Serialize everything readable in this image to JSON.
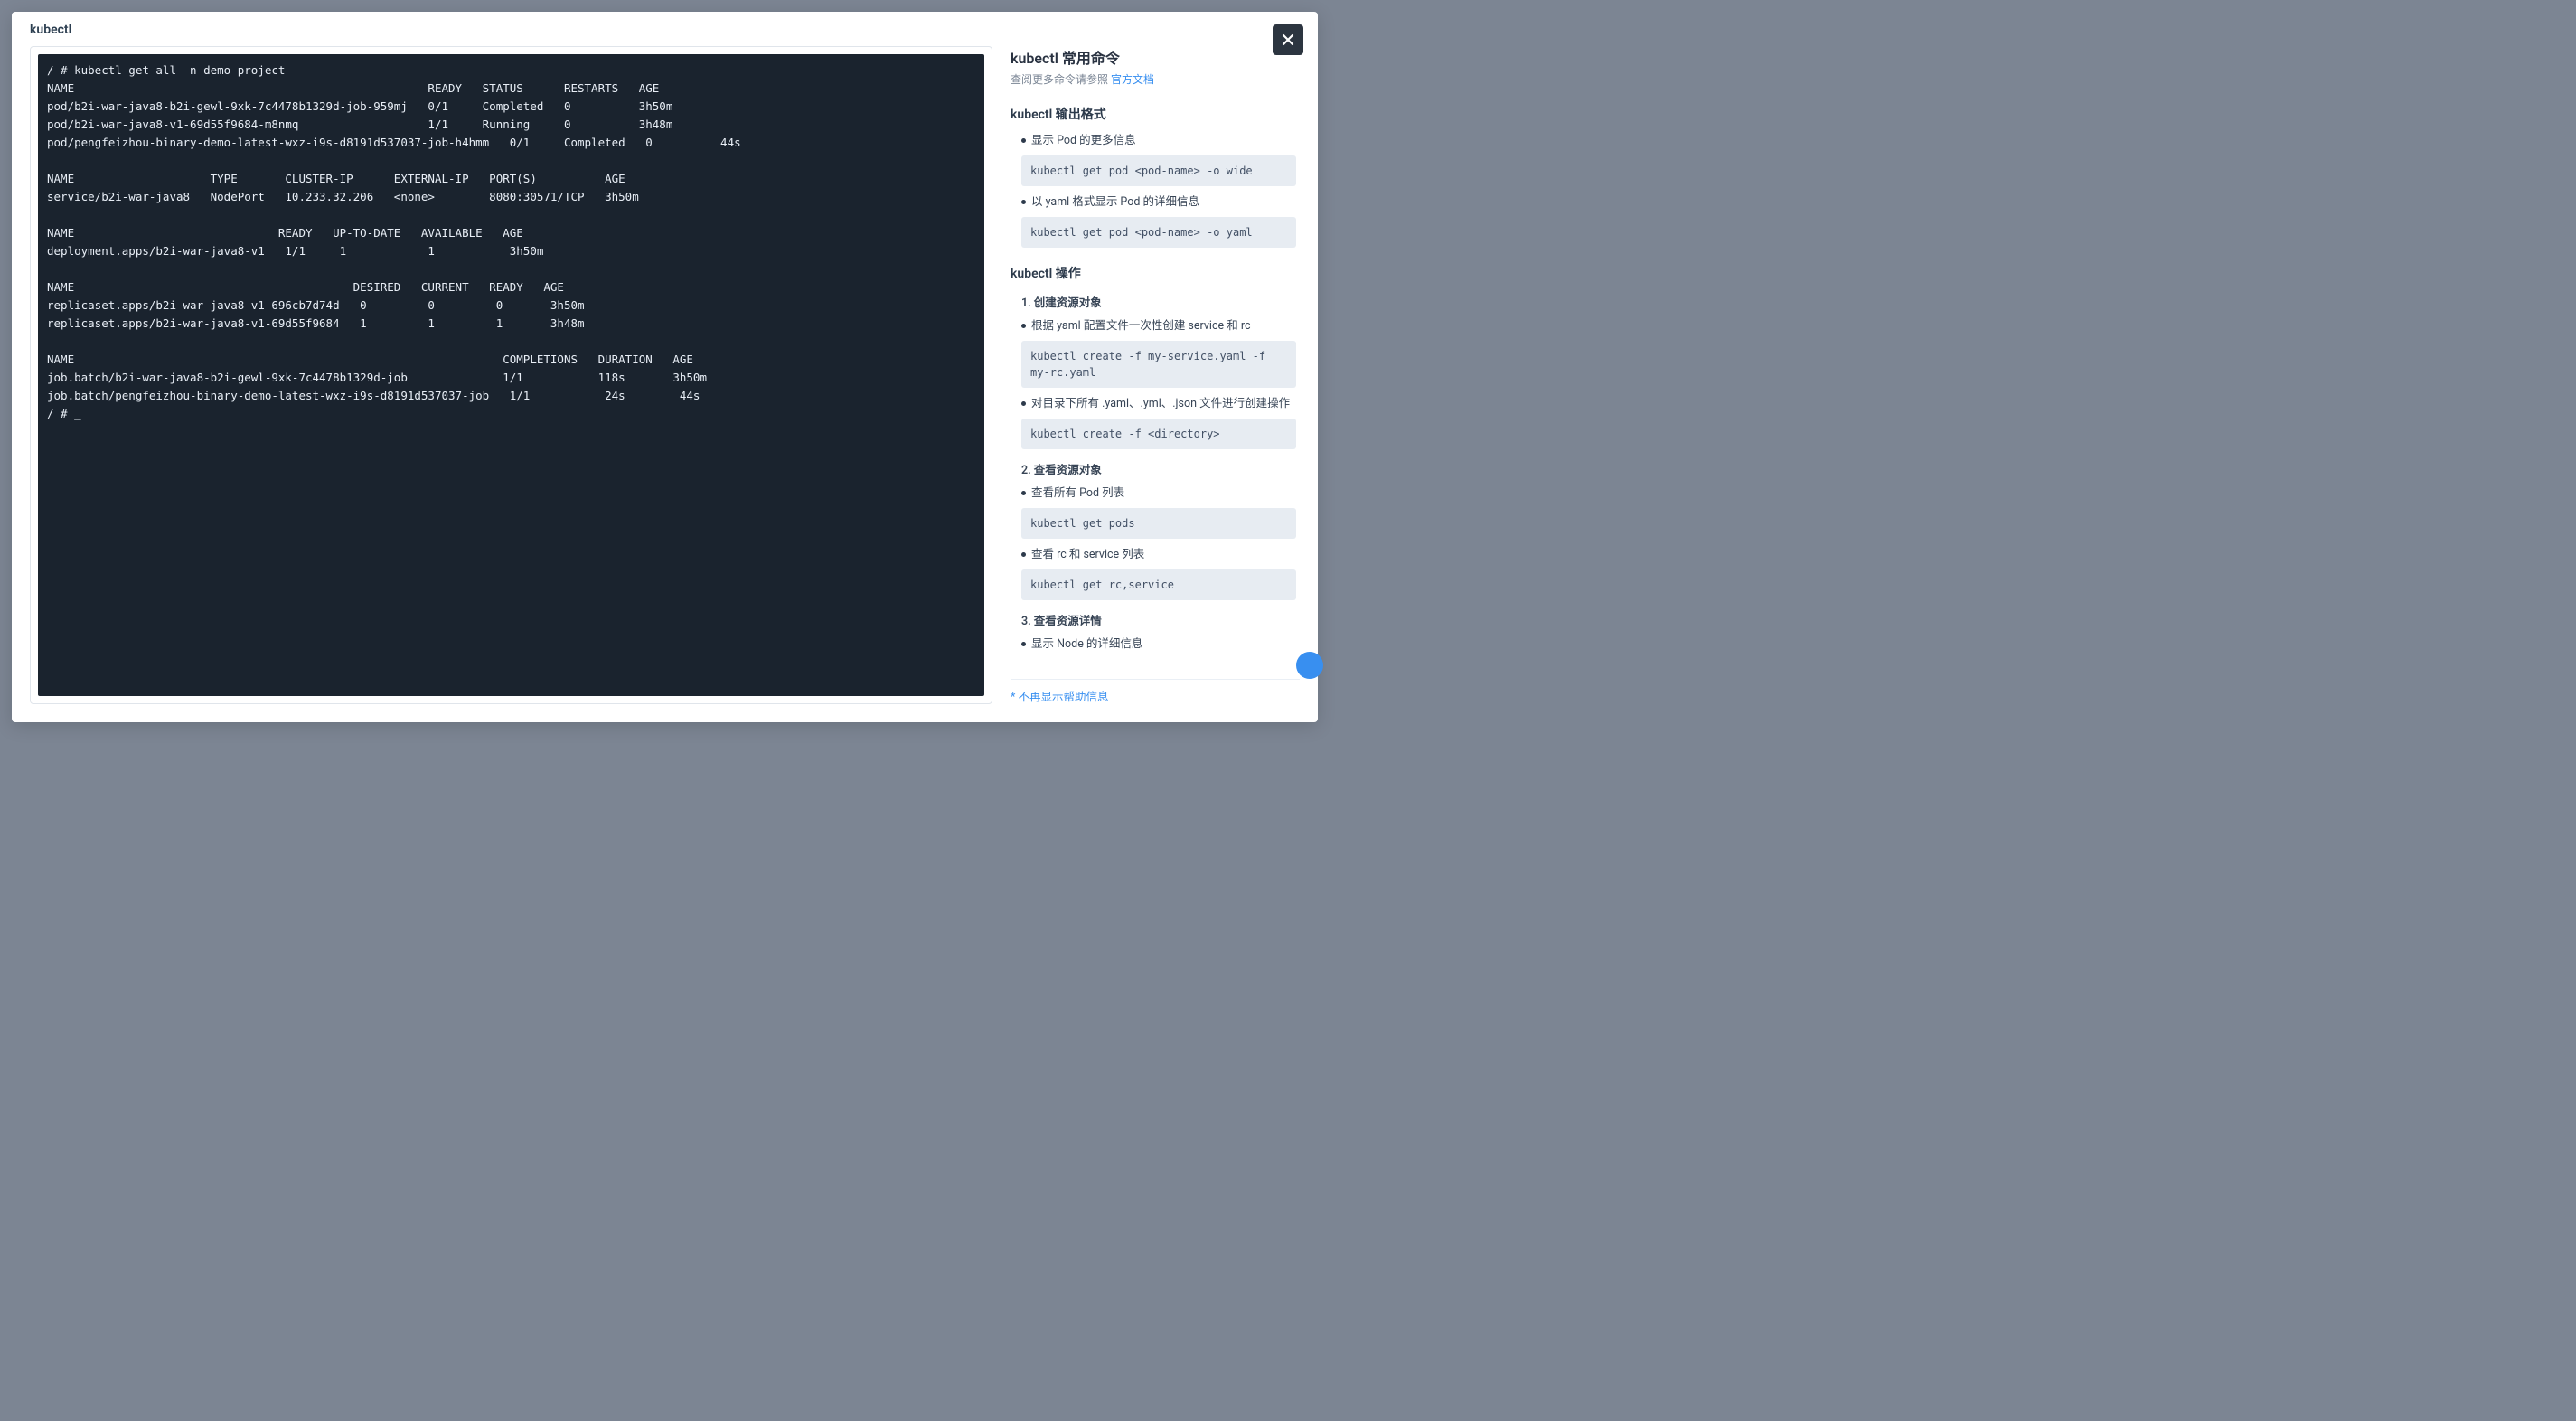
{
  "modal": {
    "title": "kubectl",
    "cursor": "_"
  },
  "terminal": {
    "content": "/ # kubectl get all -n demo-project\nNAME                                                    READY   STATUS      RESTARTS   AGE\npod/b2i-war-java8-b2i-gewl-9xk-7c4478b1329d-job-959mj   0/1     Completed   0          3h50m\npod/b2i-war-java8-v1-69d55f9684-m8nmq                   1/1     Running     0          3h48m\npod/pengfeizhou-binary-demo-latest-wxz-i9s-d8191d537037-job-h4hmm   0/1     Completed   0          44s\n\nNAME                    TYPE       CLUSTER-IP      EXTERNAL-IP   PORT(S)          AGE\nservice/b2i-war-java8   NodePort   10.233.32.206   <none>        8080:30571/TCP   3h50m\n\nNAME                              READY   UP-TO-DATE   AVAILABLE   AGE\ndeployment.apps/b2i-war-java8-v1   1/1     1            1           3h50m\n\nNAME                                         DESIRED   CURRENT   READY   AGE\nreplicaset.apps/b2i-war-java8-v1-696cb7d74d   0         0         0       3h50m\nreplicaset.apps/b2i-war-java8-v1-69d55f9684   1         1         1       3h48m\n\nNAME                                                               COMPLETIONS   DURATION   AGE\njob.batch/b2i-war-java8-b2i-gewl-9xk-7c4478b1329d-job              1/1           118s       3h50m\njob.batch/pengfeizhou-binary-demo-latest-wxz-i9s-d8191d537037-job   1/1           24s        44s\n/ # "
  },
  "help": {
    "title": "kubectl 常用命令",
    "sub_prefix": "查阅更多命令请参照 ",
    "sub_link": "官方文档",
    "section_output": "kubectl 输出格式",
    "bullets_output": {
      "b1": "显示 Pod 的更多信息",
      "c1": "kubectl get pod <pod-name> -o wide",
      "b2": "以 yaml 格式显示 Pod 的详细信息",
      "c2": "kubectl get pod <pod-name> -o yaml"
    },
    "section_ops": "kubectl 操作",
    "ops": {
      "n1": "1. 创建资源对象",
      "n1_b1": "根据 yaml 配置文件一次性创建 service 和 rc",
      "n1_c1": "kubectl create -f my-service.yaml -f my-rc.yaml",
      "n1_b2": "对目录下所有 .yaml、.yml、.json 文件进行创建操作",
      "n1_c2": "kubectl create -f <directory>",
      "n2": "2. 查看资源对象",
      "n2_b1": "查看所有 Pod 列表",
      "n2_c1": "kubectl get pods",
      "n2_b2": "查看 rc 和 service 列表",
      "n2_c2": "kubectl get rc,service",
      "n3": "3. 查看资源详情",
      "n3_b1": "显示 Node 的详细信息"
    },
    "footer": "* 不再显示帮助信息"
  }
}
